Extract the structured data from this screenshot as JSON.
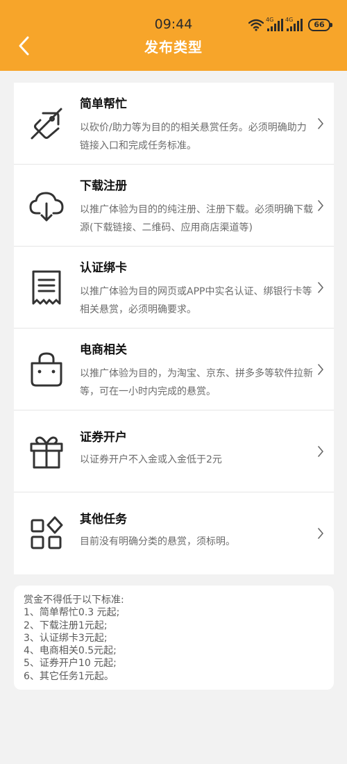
{
  "status": {
    "time": "09:44",
    "signal1": "4G",
    "signal2": "4G",
    "battery": "66"
  },
  "header": {
    "title": "发布类型"
  },
  "items": [
    {
      "title": "简单帮忙",
      "desc": "以砍价/助力等为目的的相关悬赏任务。必须明确助力链接入口和完成任务标准。",
      "icon": "broken-tag-icon"
    },
    {
      "title": "下载注册",
      "desc": "以推广体验为目的的纯注册、注册下载。必须明确下载源(下载链接、二维码、应用商店渠道等)",
      "icon": "cloud-download-icon"
    },
    {
      "title": "认证绑卡",
      "desc": "以推广体验为目的网页或APP中实名认证、绑银行卡等相关悬赏，必须明确要求。",
      "icon": "receipt-icon"
    },
    {
      "title": "电商相关",
      "desc": "以推广体验为目的，为淘宝、京东、拼多多等软件拉新等，可在一小时内完成的悬赏。",
      "icon": "shopping-bag-icon"
    },
    {
      "title": "证券开户",
      "desc": "以证券开户不入金或入金低于2元",
      "icon": "gift-icon"
    },
    {
      "title": "其他任务",
      "desc": "目前没有明确分类的悬赏，须标明。",
      "icon": "apps-icon"
    }
  ],
  "notice": {
    "lines": [
      "赏金不得低于以下标准:",
      "1、简单帮忙0.3 元起;",
      "2、下载注册1元起;",
      "3、认证绑卡3元起;",
      "4、电商相关0.5元起;",
      "5、证券开户10 元起;",
      "6、其它任务1元起。"
    ]
  },
  "colors": {
    "header": "#f7a52a",
    "background": "#f2f2f2"
  }
}
